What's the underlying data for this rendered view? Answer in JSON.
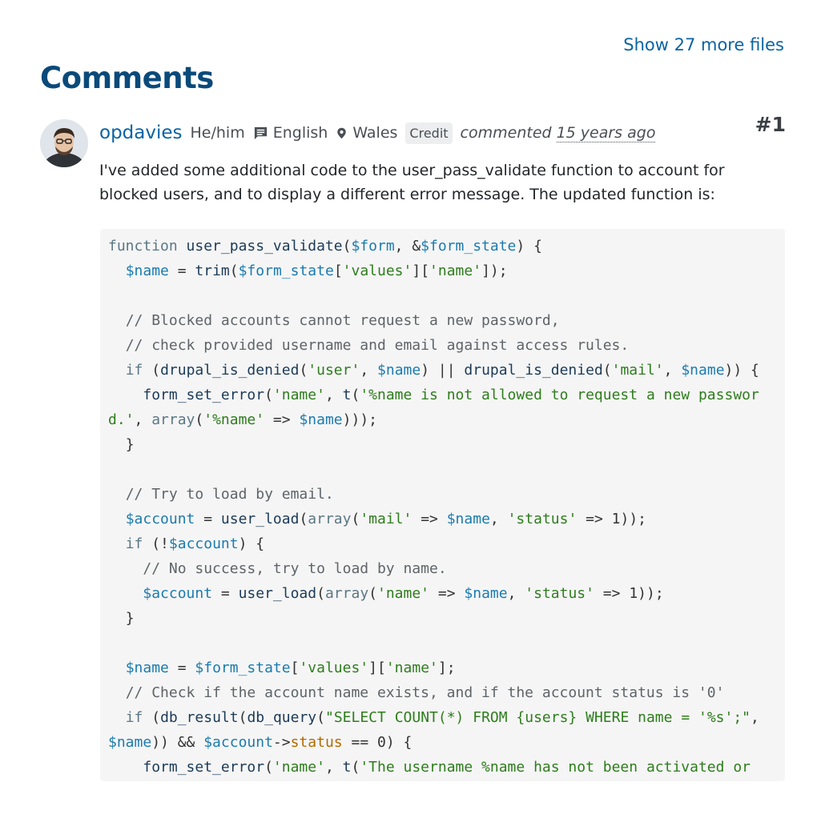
{
  "header": {
    "more_files_label": "Show 27 more files",
    "section_title": "Comments"
  },
  "comment": {
    "username": "opdavies",
    "pronouns": "He/him",
    "language": "English",
    "location": "Wales",
    "credit_label": "Credit",
    "commented_label": "commented",
    "time_ago": "15 years ago",
    "number": "#1",
    "body_text": "I've added some additional code to the user_pass_validate function to account for blocked users, and to display a different error message. The updated function is:",
    "icons": {
      "avatar": "avatar",
      "language": "chat-bubble-icon",
      "location": "map-pin-icon"
    }
  },
  "code": {
    "language": "php",
    "lines": [
      [
        [
          "kw",
          "function"
        ],
        [
          "t",
          " "
        ],
        [
          "fn",
          "user_pass_validate"
        ],
        [
          "t",
          "("
        ],
        [
          "var",
          "$form"
        ],
        [
          "t",
          ", &"
        ],
        [
          "var",
          "$form_state"
        ],
        [
          "t",
          ") {"
        ]
      ],
      [
        [
          "t",
          "  "
        ],
        [
          "var",
          "$name"
        ],
        [
          "t",
          " = "
        ],
        [
          "fn",
          "trim"
        ],
        [
          "t",
          "("
        ],
        [
          "var",
          "$form_state"
        ],
        [
          "t",
          "["
        ],
        [
          "str",
          "'values'"
        ],
        [
          "t",
          "]["
        ],
        [
          "str",
          "'name'"
        ],
        [
          "t",
          "]);"
        ]
      ],
      [
        [
          "t",
          ""
        ]
      ],
      [
        [
          "t",
          "  "
        ],
        [
          "cm",
          "// Blocked accounts cannot request a new password,"
        ]
      ],
      [
        [
          "t",
          "  "
        ],
        [
          "cm",
          "// check provided username and email against access rules."
        ]
      ],
      [
        [
          "t",
          "  "
        ],
        [
          "kw",
          "if"
        ],
        [
          "t",
          " ("
        ],
        [
          "fn",
          "drupal_is_denied"
        ],
        [
          "t",
          "("
        ],
        [
          "str",
          "'user'"
        ],
        [
          "t",
          ", "
        ],
        [
          "var",
          "$name"
        ],
        [
          "t",
          ") || "
        ],
        [
          "fn",
          "drupal_is_denied"
        ],
        [
          "t",
          "("
        ],
        [
          "str",
          "'mail'"
        ],
        [
          "t",
          ", "
        ],
        [
          "var",
          "$name"
        ],
        [
          "t",
          ")) {"
        ]
      ],
      [
        [
          "t",
          "    "
        ],
        [
          "fn",
          "form_set_error"
        ],
        [
          "t",
          "("
        ],
        [
          "str",
          "'name'"
        ],
        [
          "t",
          ", "
        ],
        [
          "fn",
          "t"
        ],
        [
          "t",
          "("
        ],
        [
          "str",
          "'%name is not allowed to request a new password.'"
        ],
        [
          "t",
          ", "
        ],
        [
          "kw",
          "array"
        ],
        [
          "t",
          "("
        ],
        [
          "str",
          "'%name'"
        ],
        [
          "t",
          " => "
        ],
        [
          "var",
          "$name"
        ],
        [
          "t",
          ")));"
        ]
      ],
      [
        [
          "t",
          "  }"
        ]
      ],
      [
        [
          "t",
          ""
        ]
      ],
      [
        [
          "t",
          "  "
        ],
        [
          "cm",
          "// Try to load by email."
        ]
      ],
      [
        [
          "t",
          "  "
        ],
        [
          "var",
          "$account"
        ],
        [
          "t",
          " = "
        ],
        [
          "fn",
          "user_load"
        ],
        [
          "t",
          "("
        ],
        [
          "kw",
          "array"
        ],
        [
          "t",
          "("
        ],
        [
          "str",
          "'mail'"
        ],
        [
          "t",
          " => "
        ],
        [
          "var",
          "$name"
        ],
        [
          "t",
          ", "
        ],
        [
          "str",
          "'status'"
        ],
        [
          "t",
          " => 1));"
        ]
      ],
      [
        [
          "t",
          "  "
        ],
        [
          "kw",
          "if"
        ],
        [
          "t",
          " (!"
        ],
        [
          "var",
          "$account"
        ],
        [
          "t",
          ") {"
        ]
      ],
      [
        [
          "t",
          "    "
        ],
        [
          "cm",
          "// No success, try to load by name."
        ]
      ],
      [
        [
          "t",
          "    "
        ],
        [
          "var",
          "$account"
        ],
        [
          "t",
          " = "
        ],
        [
          "fn",
          "user_load"
        ],
        [
          "t",
          "("
        ],
        [
          "kw",
          "array"
        ],
        [
          "t",
          "("
        ],
        [
          "str",
          "'name'"
        ],
        [
          "t",
          " => "
        ],
        [
          "var",
          "$name"
        ],
        [
          "t",
          ", "
        ],
        [
          "str",
          "'status'"
        ],
        [
          "t",
          " => 1));"
        ]
      ],
      [
        [
          "t",
          "  }"
        ]
      ],
      [
        [
          "t",
          ""
        ]
      ],
      [
        [
          "t",
          "  "
        ],
        [
          "var",
          "$name"
        ],
        [
          "t",
          " = "
        ],
        [
          "var",
          "$form_state"
        ],
        [
          "t",
          "["
        ],
        [
          "str",
          "'values'"
        ],
        [
          "t",
          "]["
        ],
        [
          "str",
          "'name'"
        ],
        [
          "t",
          "];"
        ]
      ],
      [
        [
          "t",
          "  "
        ],
        [
          "cm",
          "// Check if the account name exists, and if the account status is '0'"
        ]
      ],
      [
        [
          "t",
          "  "
        ],
        [
          "kw",
          "if"
        ],
        [
          "t",
          " ("
        ],
        [
          "fn",
          "db_result"
        ],
        [
          "t",
          "("
        ],
        [
          "fn",
          "db_query"
        ],
        [
          "t",
          "("
        ],
        [
          "str",
          "\"SELECT COUNT(*) FROM {users} WHERE name = '%s';\""
        ],
        [
          "t",
          ", "
        ],
        [
          "var",
          "$name"
        ],
        [
          "t",
          ")) && "
        ],
        [
          "var",
          "$account"
        ],
        [
          "t",
          "->"
        ],
        [
          "prop",
          "status"
        ],
        [
          "t",
          " == 0) {"
        ]
      ],
      [
        [
          "t",
          "    "
        ],
        [
          "fn",
          "form_set_error"
        ],
        [
          "t",
          "("
        ],
        [
          "str",
          "'name'"
        ],
        [
          "t",
          ", "
        ],
        [
          "fn",
          "t"
        ],
        [
          "t",
          "("
        ],
        [
          "str",
          "'The username %name has not been activated or"
        ]
      ]
    ]
  }
}
